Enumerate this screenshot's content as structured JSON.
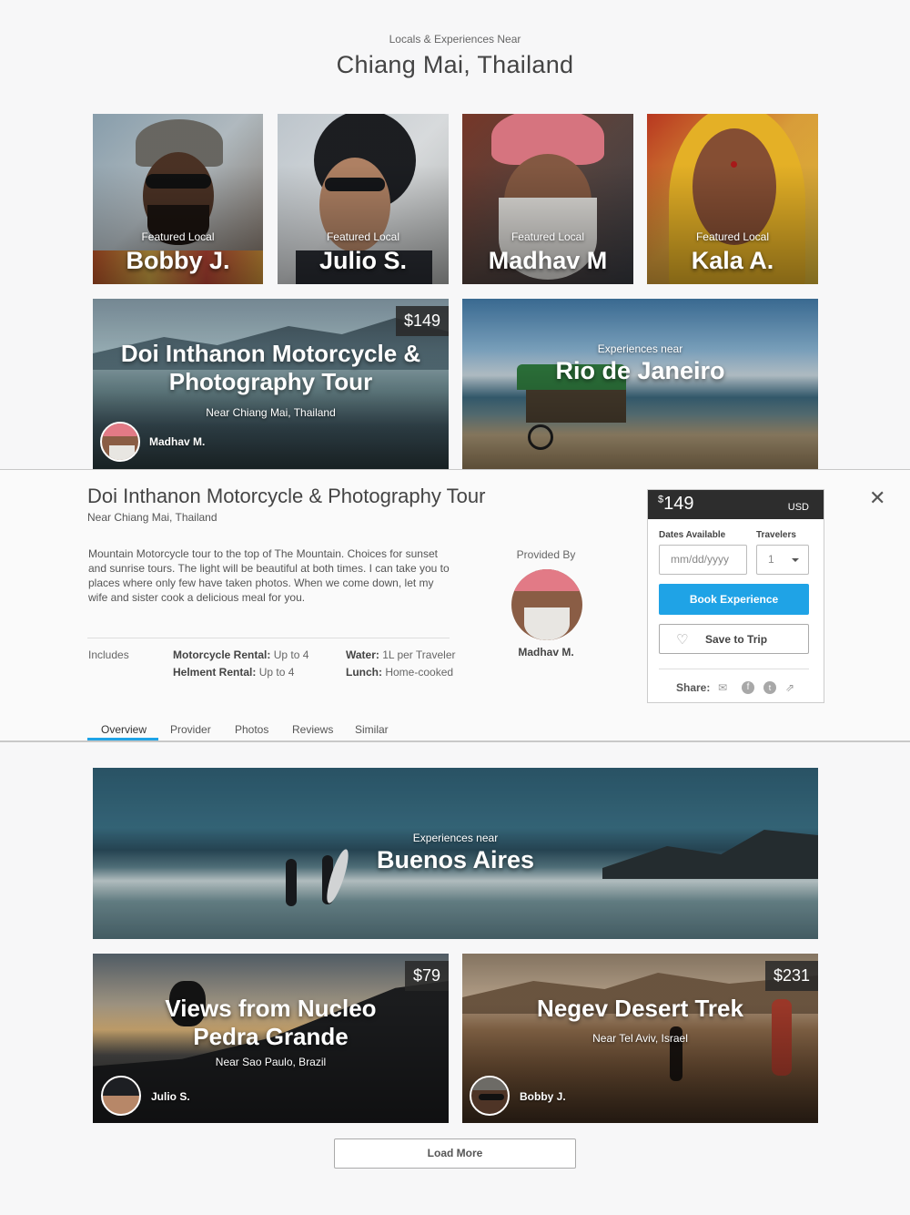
{
  "header": {
    "subtitle": "Locals & Experiences Near",
    "city": "Chiang Mai, Thailand"
  },
  "locals": [
    {
      "tag": "Featured Local",
      "name": "Bobby J."
    },
    {
      "tag": "Featured Local",
      "name": "Julio S."
    },
    {
      "tag": "Featured Local",
      "name": "Madhav M"
    },
    {
      "tag": "Featured Local",
      "name": "Kala A."
    }
  ],
  "tour_card": {
    "price": "$149",
    "title_line1": "Doi Inthanon Motorcycle &",
    "title_line2": "Photography Tour",
    "near": "Near Chiang Mai, Thailand",
    "provider": "Madhav M."
  },
  "rio_card": {
    "label": "Experiences near",
    "city": "Rio de Janeiro"
  },
  "detail": {
    "title": "Doi Inthanon Motorcycle & Photography Tour",
    "near": "Near Chiang Mai, Thailand",
    "description": "Mountain Motorcycle tour to the top of The Mountain. Choices for sunset and sunrise tours. The light will be beautiful at both times. I can take you to places where only few have taken photos. When we come down, let my wife and sister cook a delicious meal for you.",
    "includes_label": "Includes",
    "includes": [
      {
        "key": "Motorcycle Rental:",
        "value": " Up to 4"
      },
      {
        "key": "Helment Rental:",
        "value": " Up to 4"
      },
      {
        "key": "Water:",
        "value": " 1L per Traveler"
      },
      {
        "key": "Lunch:",
        "value": " Home-cooked"
      }
    ],
    "provided_by_label": "Provided By",
    "provider_name": "Madhav M.",
    "close_icon": "close-icon",
    "tabs": [
      "Overview",
      "Provider",
      "Photos",
      "Reviews",
      "Similar"
    ],
    "active_tab": "Overview",
    "accent_color": "#1fa3e6"
  },
  "booking": {
    "currency_symbol": "$",
    "amount": "149",
    "currency": "USD",
    "dates_label": "Dates Available",
    "date_placeholder": "mm/dd/yyyy",
    "travelers_label": "Travelers",
    "travelers_value": "1",
    "book_label": "Book Experience",
    "save_label": "Save to Trip",
    "share_label": "Share:",
    "share_icons": [
      "mail-icon",
      "facebook-icon",
      "twitter-icon",
      "external-link-icon"
    ]
  },
  "buenos_card": {
    "label": "Experiences near",
    "city": "Buenos Aires"
  },
  "nucleo_card": {
    "price": "$79",
    "title_line1": "Views from Nucleo",
    "title_line2": "Pedra Grande",
    "near": "Near Sao Paulo, Brazil",
    "provider": "Julio S."
  },
  "negev_card": {
    "price": "$231",
    "title_line1": "Negev Desert Trek",
    "near": "Near Tel Aviv, Israel",
    "provider": "Bobby J."
  },
  "load_more_label": "Load More"
}
